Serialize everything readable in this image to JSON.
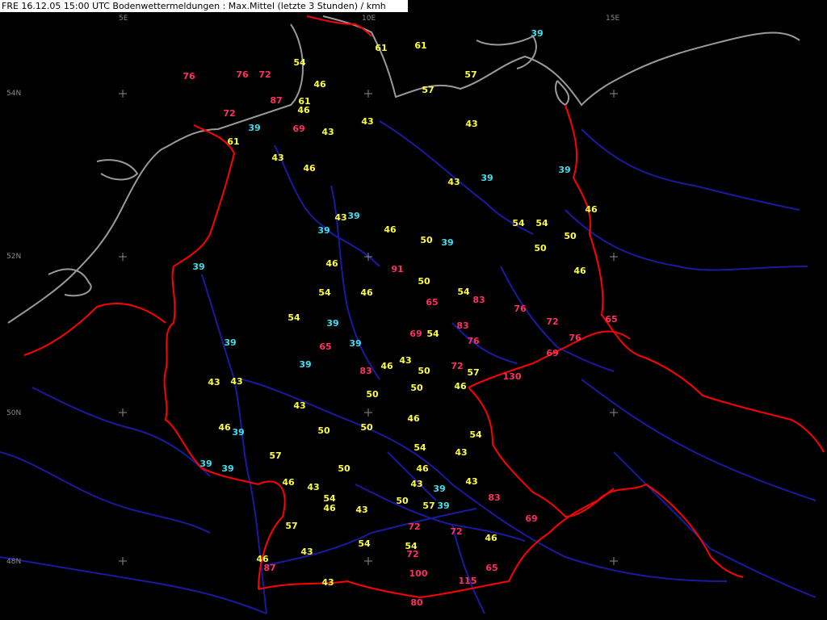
{
  "title": "FRE 16.12.05 15:00 UTC  Bodenwettermeldungen :  Max.Mittel (letzte 3 Stunden) / kmh",
  "axis_labels": [
    "5E",
    "10E",
    "15E",
    "54N",
    "52N",
    "50N",
    "48N"
  ],
  "legend_colors": {
    "cyan": "#40e0f0",
    "yellow": "#ffff40",
    "red": "#ff3060",
    "border": "#ff0000",
    "river": "#1a1aa0",
    "coast": "#9a9a9a"
  },
  "stations": [
    {
      "v": "76",
      "c": "red"
    },
    {
      "v": "76",
      "c": "red"
    },
    {
      "v": "72",
      "c": "red"
    },
    {
      "v": "54",
      "c": "yellow"
    },
    {
      "v": "61",
      "c": "yellow"
    },
    {
      "v": "61",
      "c": "yellow"
    },
    {
      "v": "39",
      "c": "cyan"
    },
    {
      "v": "46",
      "c": "yellow"
    },
    {
      "v": "57",
      "c": "yellow"
    },
    {
      "v": "57",
      "c": "yellow"
    },
    {
      "v": "87",
      "c": "red"
    },
    {
      "v": "61",
      "c": "yellow"
    },
    {
      "v": "46",
      "c": "yellow"
    },
    {
      "v": "72",
      "c": "red"
    },
    {
      "v": "39",
      "c": "cyan"
    },
    {
      "v": "69",
      "c": "red"
    },
    {
      "v": "43",
      "c": "yellow"
    },
    {
      "v": "43",
      "c": "yellow"
    },
    {
      "v": "43",
      "c": "yellow"
    },
    {
      "v": "61",
      "c": "yellow"
    },
    {
      "v": "43",
      "c": "yellow"
    },
    {
      "v": "46",
      "c": "yellow"
    },
    {
      "v": "43",
      "c": "yellow"
    },
    {
      "v": "39",
      "c": "cyan"
    },
    {
      "v": "39",
      "c": "cyan"
    },
    {
      "v": "43",
      "c": "yellow"
    },
    {
      "v": "39",
      "c": "cyan"
    },
    {
      "v": "46",
      "c": "yellow"
    },
    {
      "v": "39",
      "c": "cyan"
    },
    {
      "v": "46",
      "c": "yellow"
    },
    {
      "v": "50",
      "c": "yellow"
    },
    {
      "v": "39",
      "c": "cyan"
    },
    {
      "v": "54",
      "c": "yellow"
    },
    {
      "v": "54",
      "c": "yellow"
    },
    {
      "v": "50",
      "c": "yellow"
    },
    {
      "v": "50",
      "c": "yellow"
    },
    {
      "v": "39",
      "c": "cyan"
    },
    {
      "v": "46",
      "c": "yellow"
    },
    {
      "v": "91",
      "c": "red"
    },
    {
      "v": "50",
      "c": "yellow"
    },
    {
      "v": "46",
      "c": "yellow"
    },
    {
      "v": "54",
      "c": "yellow"
    },
    {
      "v": "46",
      "c": "yellow"
    },
    {
      "v": "65",
      "c": "red"
    },
    {
      "v": "54",
      "c": "yellow"
    },
    {
      "v": "83",
      "c": "red"
    },
    {
      "v": "76",
      "c": "red"
    },
    {
      "v": "72",
      "c": "red"
    },
    {
      "v": "65",
      "c": "red"
    },
    {
      "v": "54",
      "c": "yellow"
    },
    {
      "v": "39",
      "c": "cyan"
    },
    {
      "v": "69",
      "c": "red"
    },
    {
      "v": "54",
      "c": "yellow"
    },
    {
      "v": "83",
      "c": "red"
    },
    {
      "v": "76",
      "c": "red"
    },
    {
      "v": "76",
      "c": "red"
    },
    {
      "v": "69",
      "c": "red"
    },
    {
      "v": "39",
      "c": "cyan"
    },
    {
      "v": "65",
      "c": "red"
    },
    {
      "v": "39",
      "c": "cyan"
    },
    {
      "v": "43",
      "c": "yellow"
    },
    {
      "v": "46",
      "c": "yellow"
    },
    {
      "v": "50",
      "c": "yellow"
    },
    {
      "v": "72",
      "c": "red"
    },
    {
      "v": "57",
      "c": "yellow"
    },
    {
      "v": "39",
      "c": "cyan"
    },
    {
      "v": "83",
      "c": "red"
    },
    {
      "v": "130",
      "c": "red"
    },
    {
      "v": "43",
      "c": "yellow"
    },
    {
      "v": "43",
      "c": "yellow"
    },
    {
      "v": "50",
      "c": "yellow"
    },
    {
      "v": "46",
      "c": "yellow"
    },
    {
      "v": "50",
      "c": "yellow"
    },
    {
      "v": "43",
      "c": "yellow"
    },
    {
      "v": "46",
      "c": "yellow"
    },
    {
      "v": "46",
      "c": "yellow"
    },
    {
      "v": "39",
      "c": "cyan"
    },
    {
      "v": "50",
      "c": "yellow"
    },
    {
      "v": "50",
      "c": "yellow"
    },
    {
      "v": "54",
      "c": "yellow"
    },
    {
      "v": "54",
      "c": "yellow"
    },
    {
      "v": "43",
      "c": "yellow"
    },
    {
      "v": "57",
      "c": "yellow"
    },
    {
      "v": "39",
      "c": "cyan"
    },
    {
      "v": "39",
      "c": "cyan"
    },
    {
      "v": "50",
      "c": "yellow"
    },
    {
      "v": "46",
      "c": "yellow"
    },
    {
      "v": "46",
      "c": "yellow"
    },
    {
      "v": "43",
      "c": "yellow"
    },
    {
      "v": "43",
      "c": "yellow"
    },
    {
      "v": "39",
      "c": "cyan"
    },
    {
      "v": "43",
      "c": "yellow"
    },
    {
      "v": "54",
      "c": "yellow"
    },
    {
      "v": "46",
      "c": "yellow"
    },
    {
      "v": "50",
      "c": "yellow"
    },
    {
      "v": "57",
      "c": "yellow"
    },
    {
      "v": "39",
      "c": "cyan"
    },
    {
      "v": "83",
      "c": "red"
    },
    {
      "v": "43",
      "c": "yellow"
    },
    {
      "v": "57",
      "c": "yellow"
    },
    {
      "v": "72",
      "c": "red"
    },
    {
      "v": "72",
      "c": "red"
    },
    {
      "v": "69",
      "c": "red"
    },
    {
      "v": "46",
      "c": "yellow"
    },
    {
      "v": "54",
      "c": "yellow"
    },
    {
      "v": "54",
      "c": "yellow"
    },
    {
      "v": "72",
      "c": "red"
    },
    {
      "v": "43",
      "c": "yellow"
    },
    {
      "v": "46",
      "c": "yellow"
    },
    {
      "v": "87",
      "c": "red"
    },
    {
      "v": "100",
      "c": "red"
    },
    {
      "v": "115",
      "c": "red"
    },
    {
      "v": "65",
      "c": "red"
    },
    {
      "v": "43",
      "c": "yellow"
    },
    {
      "v": "80",
      "c": "red"
    }
  ]
}
